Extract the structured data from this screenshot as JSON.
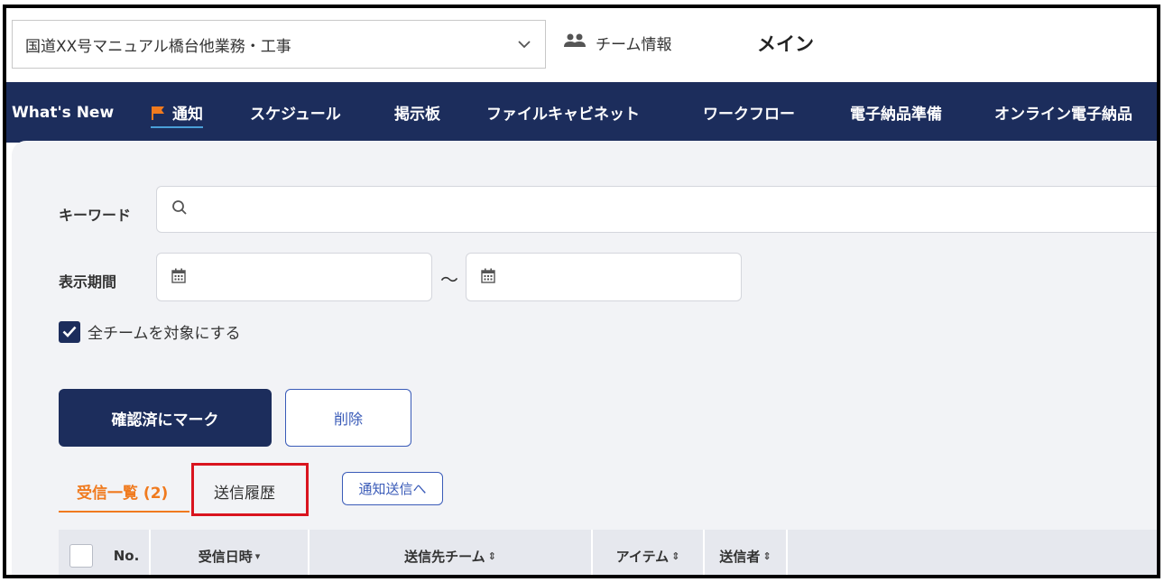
{
  "header": {
    "project_select_value": "国道XX号マニュアル橋台他業務・工事",
    "team_info_label": "チーム情報",
    "main_title": "メイン"
  },
  "nav": {
    "items": [
      {
        "label": "What's New"
      },
      {
        "label": "通知"
      },
      {
        "label": "スケジュール"
      },
      {
        "label": "掲示板"
      },
      {
        "label": "ファイルキャビネット"
      },
      {
        "label": "ワークフロー"
      },
      {
        "label": "電子納品準備"
      },
      {
        "label": "オンライン電子納品"
      }
    ],
    "active_index": 1
  },
  "filters": {
    "keyword_label": "キーワード",
    "keyword_value": "",
    "period_label": "表示期間",
    "period_separator": "～",
    "period_from": "",
    "period_to": "",
    "all_teams_label": "全チームを対象にする",
    "all_teams_checked": true
  },
  "actions": {
    "mark_confirmed_label": "確認済にマーク",
    "delete_label": "削除"
  },
  "tabs": {
    "received_label": "受信一覧 (2)",
    "sent_label": "送信履歴",
    "send_notification_label": "通知送信へ"
  },
  "table": {
    "columns": [
      {
        "label": "No."
      },
      {
        "label": "受信日時",
        "sort": "▾"
      },
      {
        "label": "送信先チーム",
        "sort": "⇕"
      },
      {
        "label": "アイテム",
        "sort": "⇕"
      },
      {
        "label": "送信者",
        "sort": "⇕"
      }
    ]
  },
  "colors": {
    "nav_bg": "#1c2d5c",
    "accent_orange": "#f07a1e",
    "highlight_red": "#d9141e",
    "outline_blue": "#3a5bb8"
  }
}
